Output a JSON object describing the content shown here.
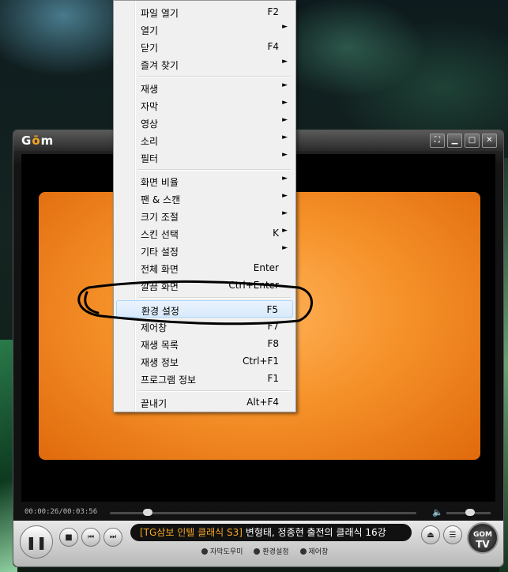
{
  "player": {
    "logo_prefix": "G",
    "logo_o": "ō",
    "logo_suffix": "m",
    "time": "00:00:26/00:03:56",
    "ticker_tag": "[TG삼보 인텔 클래식 S3]",
    "ticker_text": "변형태, 정종현 출전의 클래식 16강",
    "sub_links": [
      "자막도우미",
      "환경설정",
      "제어창"
    ],
    "gomtv_top": "GOM",
    "gomtv_bottom": "TV",
    "seek_progress": 0.11,
    "volume_level": 0.55
  },
  "menu": {
    "items": [
      {
        "label": "파일 열기",
        "shortcut": "F2"
      },
      {
        "label": "열기",
        "submenu": true
      },
      {
        "label": "닫기",
        "shortcut": "F4"
      },
      {
        "label": "즐겨 찾기",
        "submenu": true
      },
      {
        "label": "재생",
        "submenu": true
      },
      {
        "label": "자막",
        "submenu": true
      },
      {
        "label": "영상",
        "submenu": true
      },
      {
        "label": "소리",
        "submenu": true
      },
      {
        "label": "필터",
        "submenu": true
      },
      {
        "label": "화면 비율",
        "submenu": true
      },
      {
        "label": "팬 & 스캔",
        "submenu": true
      },
      {
        "label": "크기 조절",
        "submenu": true
      },
      {
        "label": "스킨 선택",
        "shortcut": "K",
        "submenu": true
      },
      {
        "label": "기타 설정",
        "submenu": true
      },
      {
        "label": "전체 화면",
        "shortcut": "Enter"
      },
      {
        "label": "깔끔 화면",
        "shortcut": "Ctrl+Enter"
      },
      {
        "label": "환경 설정",
        "shortcut": "F5",
        "selected": true
      },
      {
        "label": "제어창",
        "shortcut": "F7"
      },
      {
        "label": "재생 목록",
        "shortcut": "F8"
      },
      {
        "label": "재생 정보",
        "shortcut": "Ctrl+F1"
      },
      {
        "label": "프로그램 정보",
        "shortcut": "F1"
      },
      {
        "label": "끝내기",
        "shortcut": "Alt+F4"
      }
    ]
  },
  "colors": {
    "accent": "#f6a623",
    "annotation": "#000000",
    "menu_highlight": "#d9eafc"
  }
}
